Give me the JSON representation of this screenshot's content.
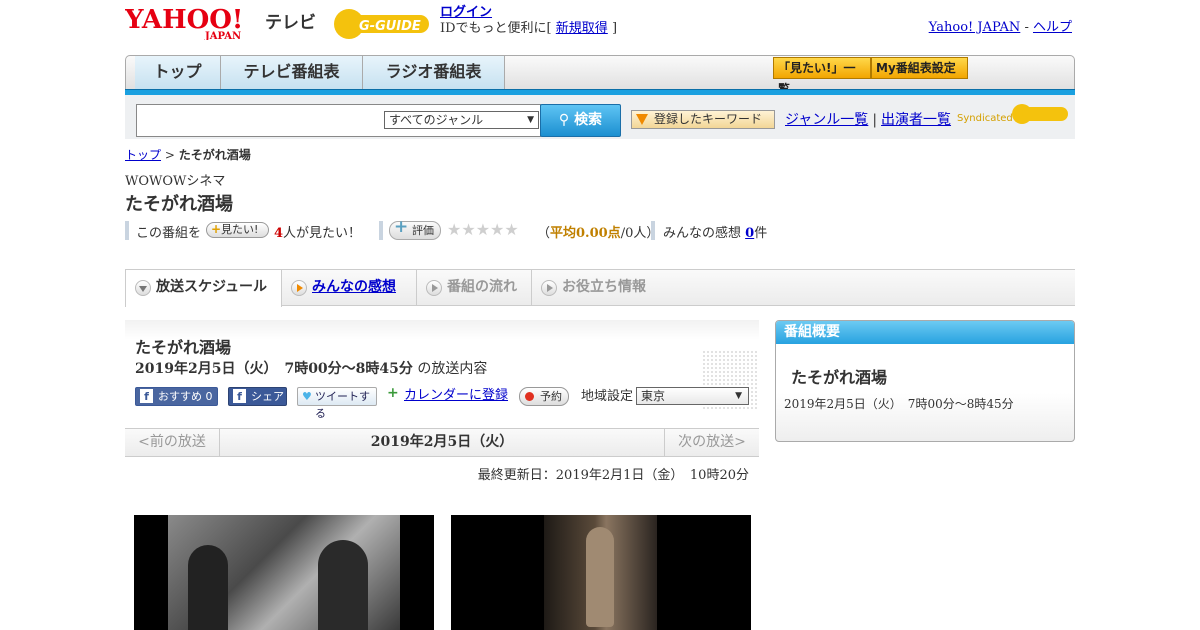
{
  "header": {
    "yahoo_logo_text": "YAHOO!",
    "yahoo_logo_sub": "JAPAN",
    "tv_label": "テレビ",
    "gguide_logo_text": "G-GUIDE",
    "login_link": "ログイン",
    "id_text": "IDでもっと便利に[",
    "register_link": "新規取得",
    "id_text_end": "]",
    "yahoo_japan_link": "Yahoo! JAPAN",
    "link_sep": "-",
    "help_link": "ヘルプ"
  },
  "nav": {
    "tabs": [
      {
        "label": "トップ"
      },
      {
        "label": "テレビ番組表"
      },
      {
        "label": "ラジオ番組表"
      }
    ],
    "mitai_list": "「見たい!」一覧",
    "my_schedule": "My番組表設定"
  },
  "search": {
    "input_value": "",
    "genre_selected": "すべてのジャンル",
    "search_button": "検索",
    "keyword_button": "登録したキーワード",
    "genre_list_link": "ジャンル一覧",
    "sep": "|",
    "performer_list_link": "出演者一覧",
    "syndicated": "Syndicated"
  },
  "breadcrumb": {
    "top_link": "トップ",
    "sep": ">",
    "current": "たそがれ酒場"
  },
  "program": {
    "channel": "WOWOWシネマ",
    "title": "たそがれ酒場"
  },
  "stats": {
    "prefix": "この番組を",
    "mitai_button": "見たい!",
    "count": "4",
    "count_suffix": "人が見たい！",
    "hyoka_button": "評価",
    "stars": "★★★★★",
    "rating_open": "（",
    "rating_label": "平均0.00点",
    "rating_people": "/0人）",
    "impressions_label": "みんなの感想",
    "impressions_count": "0",
    "impressions_suffix": "件"
  },
  "tabs": [
    {
      "label": "放送スケジュール"
    },
    {
      "label": "みんなの感想"
    },
    {
      "label": "番組の流れ"
    },
    {
      "label": "お役立ち情報"
    }
  ],
  "broadcast": {
    "title": "たそがれ酒場",
    "datetime": "2019年2月5日（火）　7時00分～8時45分",
    "suffix": "の放送内容",
    "fb_recommend": "おすすめ 0",
    "fb_share": "シェア",
    "tweet": "ツイートする",
    "calendar": "カレンダーに登録",
    "yoyaku": "予約",
    "region_label": "地域設定",
    "region_selected": "東京",
    "prev": "<前の放送",
    "date": "2019年2月5日（火）",
    "next": "次の放送>",
    "updated": "最終更新日：2019年2月1日（金）　10時20分"
  },
  "summary": {
    "header": "番組概要",
    "title": "たそがれ酒場",
    "time": "2019年2月5日（火）　7時00分～8時45分"
  },
  "colors": {
    "accent_blue": "#1aa0e0",
    "link": "#0000cc",
    "orange_button": "#f2a500"
  }
}
